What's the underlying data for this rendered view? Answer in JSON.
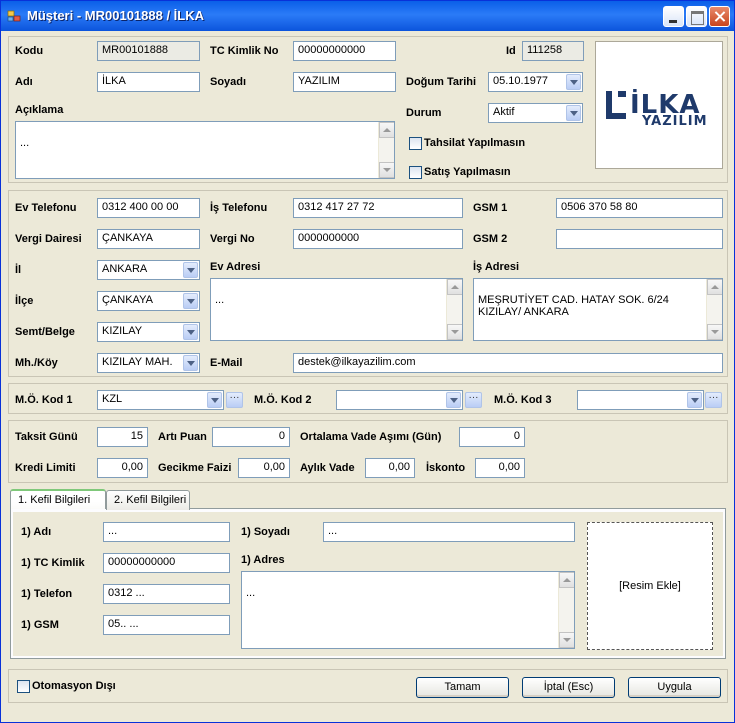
{
  "window": {
    "title": "Müşteri - MR00101888 / İLKA"
  },
  "header": {
    "kodu_label": "Kodu",
    "kodu_value": "MR00101888",
    "tc_label": "TC Kimlik No",
    "tc_value": "00000000000",
    "id_label": "Id",
    "id_value": "111258",
    "adi_label": "Adı",
    "adi_value": "İLKA",
    "soyadi_label": "Soyadı",
    "soyadi_value": "YAZILIM",
    "dogum_label": "Doğum Tarihi",
    "dogum_value": "05.10.1977",
    "aciklama_label": "Açıklama",
    "aciklama_value": "...",
    "durum_label": "Durum",
    "durum_value": "Aktif",
    "tahsilat_label": "Tahsilat Yapılmasın",
    "satis_label": "Satış Yapılmasın",
    "logo_line1": "İLKA",
    "logo_line2": "YAZILIM"
  },
  "contact": {
    "ev_tel_label": "Ev Telefonu",
    "ev_tel_value": "0312 400 00 00",
    "is_tel_label": "İş Telefonu",
    "is_tel_value": "0312 417 27 72",
    "gsm1_label": "GSM 1",
    "gsm1_value": "0506 370 58 80",
    "vd_label": "Vergi Dairesi",
    "vd_value": "ÇANKAYA",
    "vno_label": "Vergi No",
    "vno_value": "0000000000",
    "gsm2_label": "GSM 2",
    "gsm2_value": "",
    "il_label": "İl",
    "il_value": "ANKARA",
    "ev_adres_label": "Ev Adresi",
    "ev_adres_value": "...",
    "is_adres_label": "İş Adresi",
    "is_adres_value": "MEŞRUTİYET CAD. HATAY SOK. 6/24\nKIZILAY/ ANKARA",
    "ilce_label": "İlçe",
    "ilce_value": "ÇANKAYA",
    "semt_label": "Semt/Belge",
    "semt_value": "KIZILAY",
    "mh_label": "Mh./Köy",
    "mh_value": "KIZILAY MAH.",
    "email_label": "E-Mail",
    "email_value": "destek@ilkayazilim.com"
  },
  "codes": {
    "kod1_label": "M.Ö. Kod 1",
    "kod1_value": "KZL",
    "kod2_label": "M.Ö. Kod 2",
    "kod2_value": "",
    "kod3_label": "M.Ö. Kod 3",
    "kod3_value": "",
    "ellipsis": "···"
  },
  "finance": {
    "taksit_label": "Taksit Günü",
    "taksit_value": "15",
    "arti_label": "Artı Puan",
    "arti_value": "0",
    "ortalama_label": "Ortalama Vade Aşımı (Gün)",
    "ortalama_value": "0",
    "kredi_label": "Kredi Limiti",
    "kredi_value": "0,00",
    "gecikme_label": "Gecikme Faizi",
    "gecikme_value": "0,00",
    "aylik_label": "Aylık Vade",
    "aylik_value": "0,00",
    "iskonto_label": "İskonto",
    "iskonto_value": "0,00"
  },
  "tabs": [
    {
      "label": "1. Kefil Bilgileri"
    },
    {
      "label": "2. Kefil Bilgileri"
    }
  ],
  "guarantor": {
    "adi_label": "1) Adı",
    "adi_value": "...",
    "soyadi_label": "1) Soyadı",
    "soyadi_value": "...",
    "tc_label": "1) TC Kimlik",
    "tc_value": "00000000000",
    "adres_label": "1) Adres",
    "adres_value": "...",
    "telefon_label": "1) Telefon",
    "telefon_value": "0312 ...",
    "gsm_label": "1) GSM",
    "gsm_value": "05.. ...",
    "photo_label": "[Resim Ekle]"
  },
  "footer": {
    "otomasyon_label": "Otomasyon Dışı",
    "tamam": "Tamam",
    "iptal": "İptal (Esc)",
    "uygula": "Uygula"
  }
}
